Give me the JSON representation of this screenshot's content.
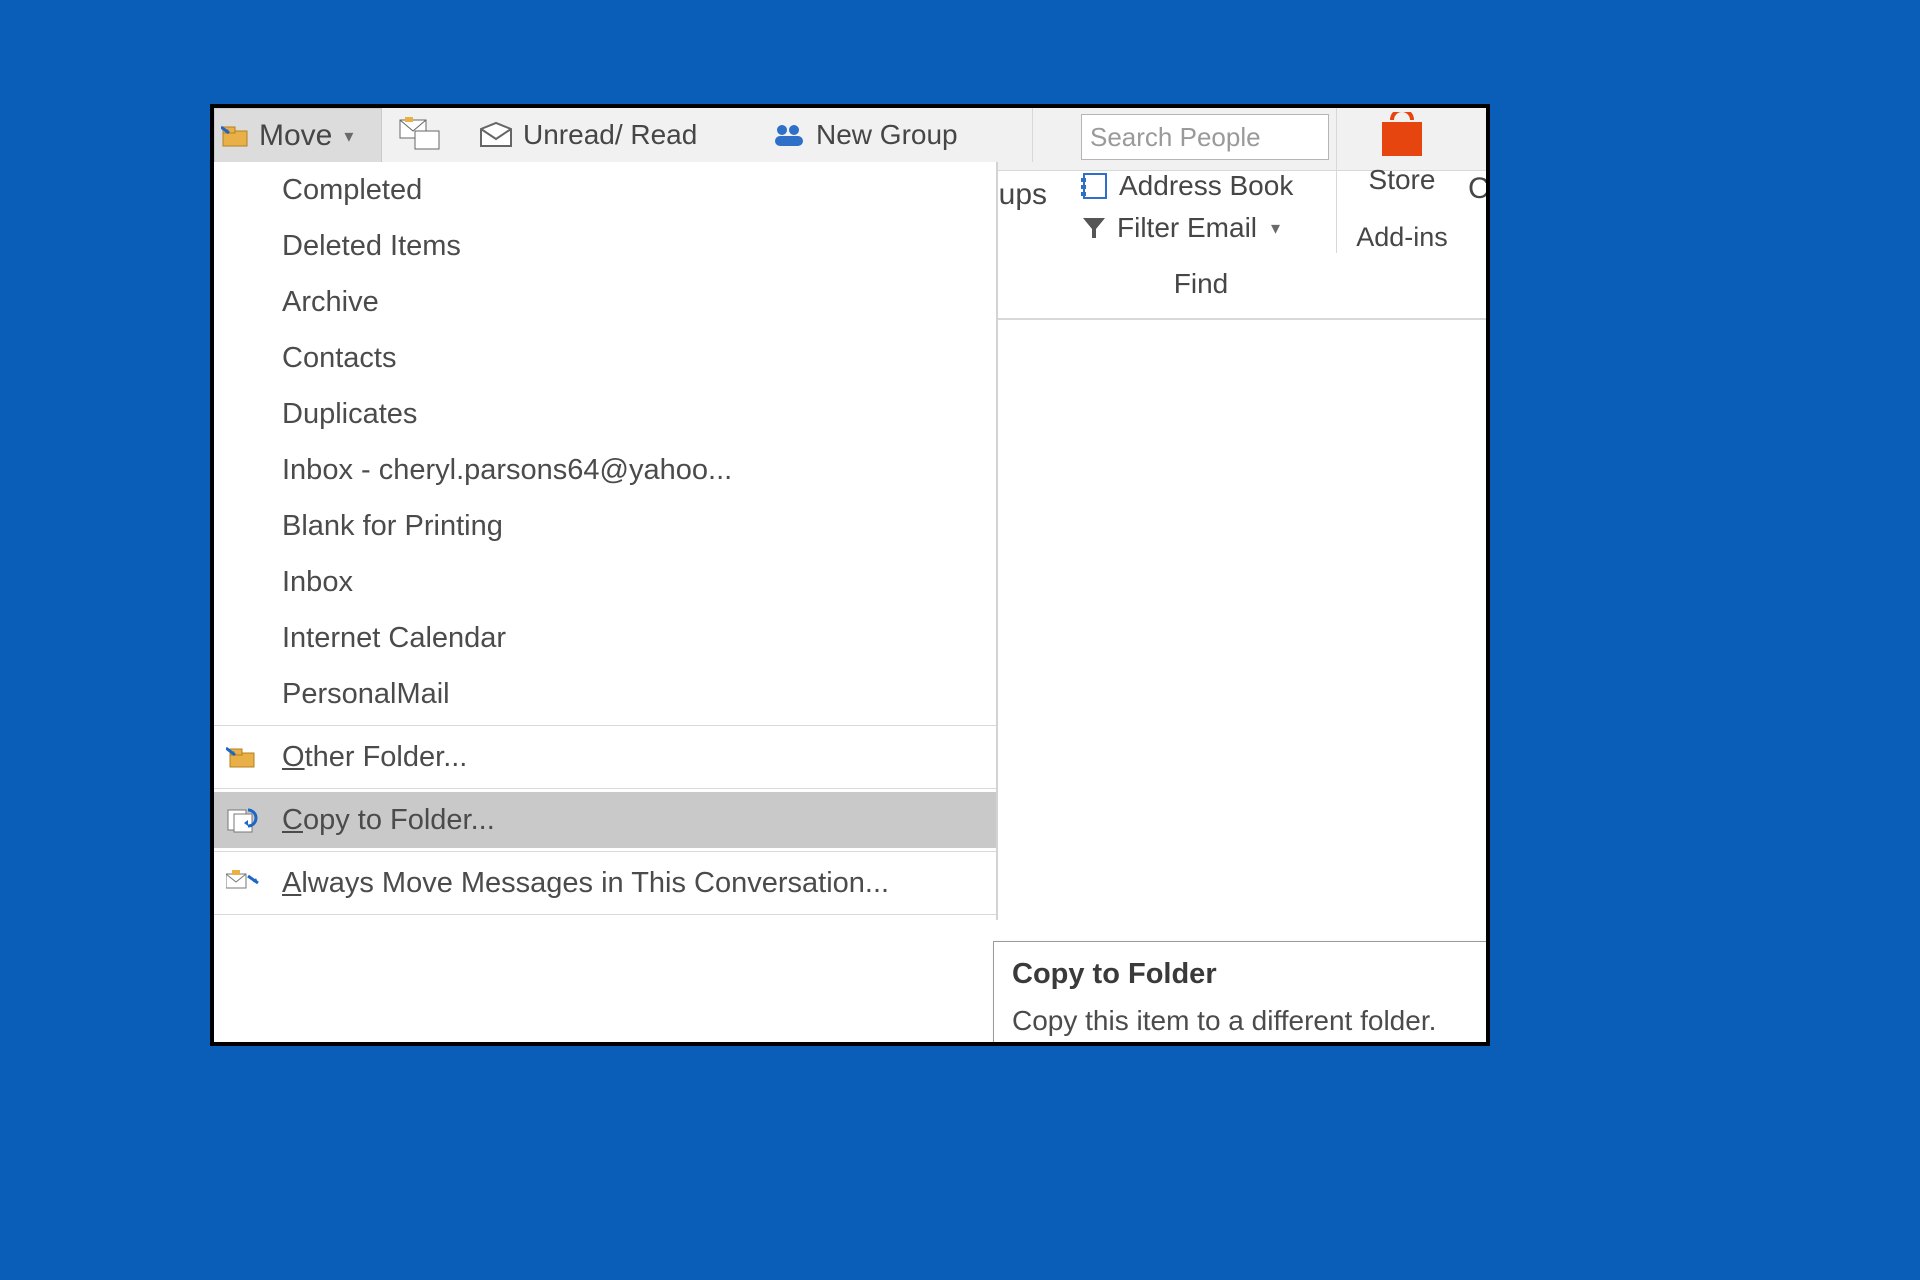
{
  "ribbon": {
    "move_label": "Move",
    "unread_label": "Unread/ Read",
    "new_group_label": "New Group",
    "groups_fragment": "oups",
    "search_placeholder": "Search People",
    "address_book_label": "Address Book",
    "filter_email_label": "Filter Email",
    "find_label": "Find",
    "store_label": "Store",
    "addins_label": "Add-ins",
    "right_letter": "C"
  },
  "move_menu": {
    "items": [
      "Completed",
      "Deleted Items",
      "Archive",
      "Contacts",
      "Duplicates",
      "Inbox - cheryl.parsons64@yahoo...",
      "Blank for Printing",
      "Inbox",
      "Internet Calendar",
      "PersonalMail"
    ],
    "other_folder_label": "ther Folder...",
    "other_folder_prefix": "O",
    "copy_to_folder_label": "opy to Folder...",
    "copy_to_folder_prefix": "C",
    "always_move_prefix": "A",
    "always_move_label": "lways Move Messages in This Conversation..."
  },
  "tooltip": {
    "title": "Copy to Folder",
    "body": "Copy this item to a different folder."
  }
}
